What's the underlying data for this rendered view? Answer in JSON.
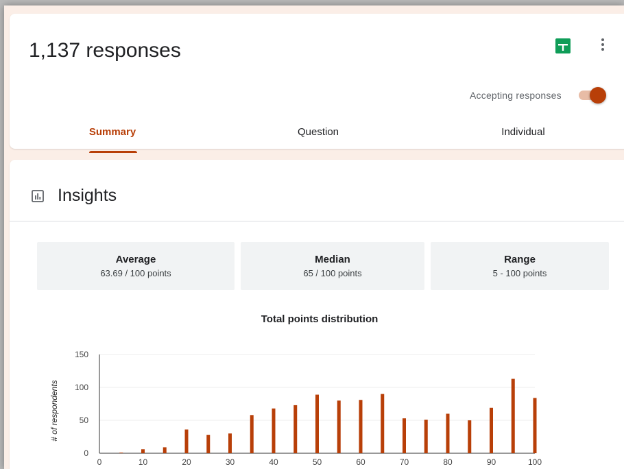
{
  "header": {
    "responses_title": "1,137 responses",
    "accepting_label": "Accepting responses",
    "accepting_on": true
  },
  "tabs": [
    {
      "label": "Summary",
      "active": true
    },
    {
      "label": "Question",
      "active": false
    },
    {
      "label": "Individual",
      "active": false
    }
  ],
  "insights": {
    "title": "Insights",
    "stats": [
      {
        "label": "Average",
        "value": "63.69 / 100 points"
      },
      {
        "label": "Median",
        "value": "65 / 100 points"
      },
      {
        "label": "Range",
        "value": "5 - 100 points"
      }
    ]
  },
  "colors": {
    "accent": "#b83f08",
    "sheets_green": "#0f9d58"
  },
  "chart_data": {
    "type": "bar",
    "title": "Total points distribution",
    "xlabel": "",
    "ylabel": "# of respondents",
    "x": [
      5,
      10,
      15,
      20,
      25,
      30,
      35,
      40,
      45,
      50,
      55,
      60,
      65,
      70,
      75,
      80,
      85,
      90,
      95,
      100
    ],
    "values": [
      1,
      6,
      9,
      36,
      28,
      30,
      58,
      68,
      73,
      89,
      80,
      81,
      90,
      53,
      51,
      60,
      50,
      69,
      113,
      84
    ],
    "xlim": [
      0,
      100
    ],
    "ylim": [
      0,
      150
    ],
    "x_ticks": [
      0,
      10,
      20,
      30,
      40,
      50,
      60,
      70,
      80,
      90,
      100
    ],
    "y_ticks": [
      0,
      50,
      100,
      150
    ],
    "grid": true,
    "bar_color": "#b83f08"
  }
}
